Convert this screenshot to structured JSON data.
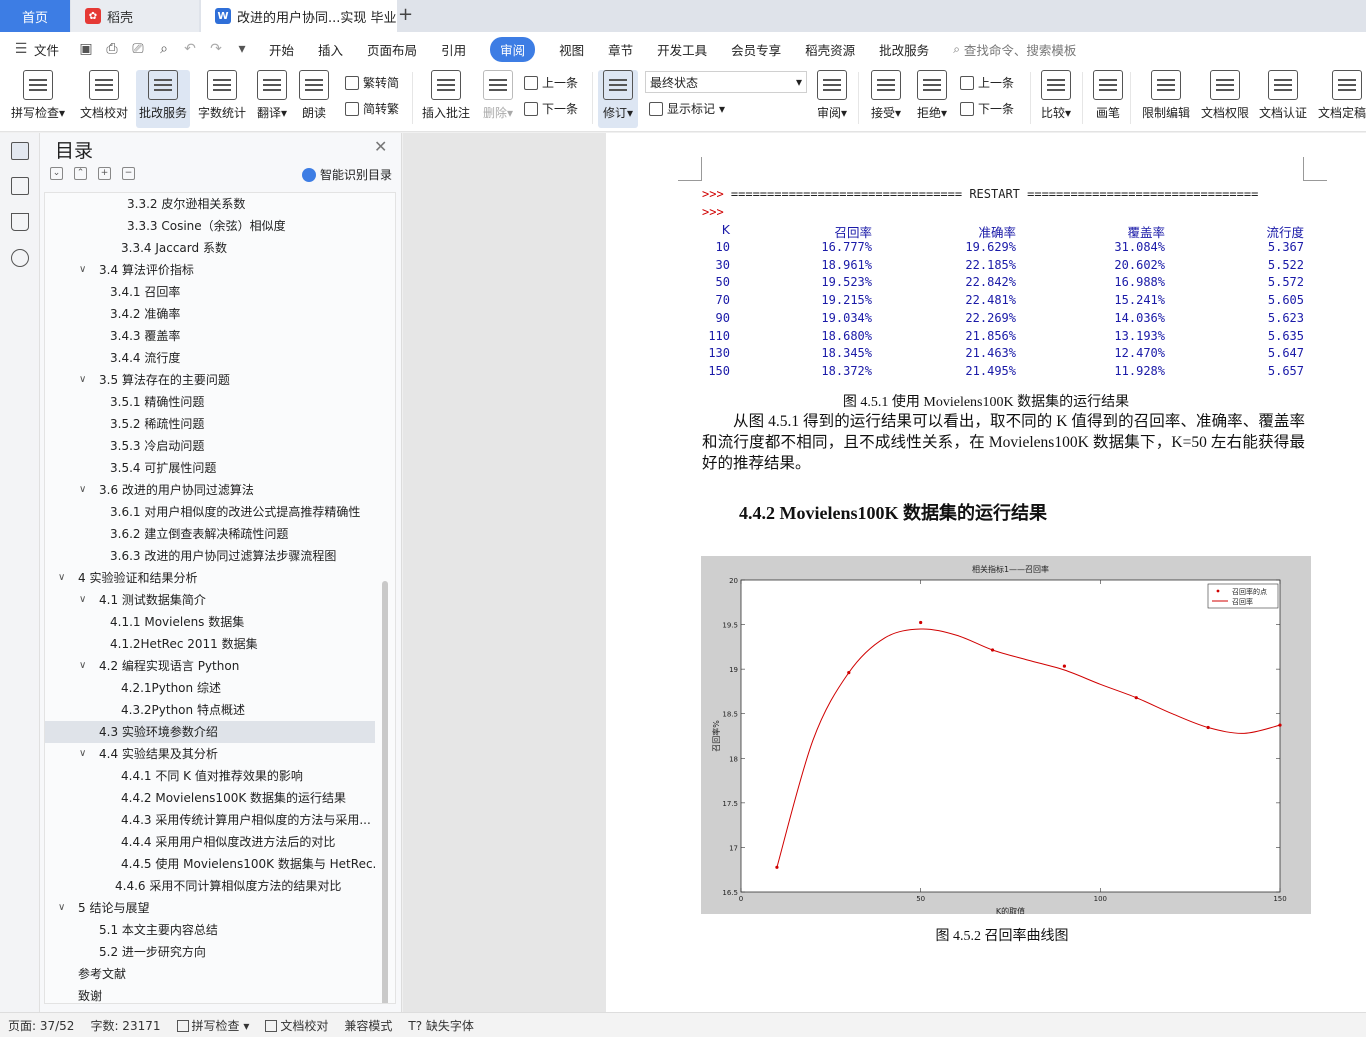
{
  "tabs": {
    "home": "首页",
    "daoke": "稻壳",
    "doc": "改进的用户协同...实现 毕业论文"
  },
  "menu": {
    "file": "文件",
    "items": [
      "开始",
      "插入",
      "页面布局",
      "引用",
      "审阅",
      "视图",
      "章节",
      "开发工具",
      "会员专享",
      "稻壳资源",
      "批改服务"
    ],
    "active": "审阅",
    "search": "查找命令、搜索模板"
  },
  "ribbon": {
    "spell": "拼写检查",
    "doc_check": "文档校对",
    "review_service": "批改服务",
    "word_count": "字数统计",
    "translate": "翻译",
    "read_aloud": "朗读",
    "trad": "繁转简",
    "simp": "简转繁",
    "insert_comment": "插入批注",
    "delete": "删除",
    "prev": "上一条",
    "next": "下一条",
    "track": "修订",
    "final_state": "最终状态",
    "show_marks": "显示标记",
    "review": "审阅",
    "accept": "接受",
    "reject": "拒绝",
    "prev2": "上一条",
    "next2": "下一条",
    "compare": "比较",
    "pen": "画笔",
    "restrict": "限制编辑",
    "perm": "文档权限",
    "cert": "文档认证",
    "final": "文档定稿"
  },
  "toc": {
    "title": "目录",
    "smart": "智能识别目录",
    "items": [
      {
        "text": "3.3.2 皮尔逊相关系数",
        "indent": 82,
        "chev": false
      },
      {
        "text": "3.3.3 Cosine（余弦）相似度",
        "indent": 82,
        "chev": false
      },
      {
        "text": "3.3.4 Jaccard  系数",
        "indent": 76,
        "chev": false
      },
      {
        "text": "3.4 算法评价指标",
        "indent": 54,
        "chev": true
      },
      {
        "text": "3.4.1 召回率",
        "indent": 65,
        "chev": false
      },
      {
        "text": "3.4.2 准确率",
        "indent": 65,
        "chev": false
      },
      {
        "text": "3.4.3 覆盖率",
        "indent": 65,
        "chev": false
      },
      {
        "text": "3.4.4 流行度",
        "indent": 65,
        "chev": false
      },
      {
        "text": "3.5 算法存在的主要问题",
        "indent": 54,
        "chev": true
      },
      {
        "text": "3.5.1 精确性问题",
        "indent": 65,
        "chev": false
      },
      {
        "text": "3.5.2 稀疏性问题",
        "indent": 65,
        "chev": false
      },
      {
        "text": "3.5.3 冷启动问题",
        "indent": 65,
        "chev": false
      },
      {
        "text": "3.5.4 可扩展性问题",
        "indent": 65,
        "chev": false
      },
      {
        "text": "3.6 改进的用户协同过滤算法",
        "indent": 54,
        "chev": true
      },
      {
        "text": "3.6.1 对用户相似度的改进公式提高推荐精确性",
        "indent": 65,
        "chev": false
      },
      {
        "text": "3.6.2 建立倒查表解决稀疏性问题",
        "indent": 65,
        "chev": false
      },
      {
        "text": "3.6.3 改进的用户协同过滤算法步骤流程图",
        "indent": 65,
        "chev": false
      },
      {
        "text": "4 实验验证和结果分析",
        "indent": 33,
        "chev": true
      },
      {
        "text": "4.1 测试数据集简介",
        "indent": 54,
        "chev": true
      },
      {
        "text": "4.1.1 Movielens 数据集",
        "indent": 65,
        "chev": false
      },
      {
        "text": "4.1.2HetRec 2011 数据集",
        "indent": 65,
        "chev": false
      },
      {
        "text": "4.2 编程实现语言 Python",
        "indent": 54,
        "chev": true
      },
      {
        "text": "4.2.1Python 综述",
        "indent": 76,
        "chev": false
      },
      {
        "text": "4.3.2Python 特点概述",
        "indent": 76,
        "chev": false
      },
      {
        "text": "4.3 实验环境参数介绍",
        "indent": 54,
        "chev": false,
        "selected": true
      },
      {
        "text": "4.4 实验结果及其分析",
        "indent": 54,
        "chev": true
      },
      {
        "text": "4.4.1 不同 K 值对推荐效果的影响",
        "indent": 76,
        "chev": false
      },
      {
        "text": "4.4.2 Movielens100K 数据集的运行结果",
        "indent": 76,
        "chev": false
      },
      {
        "text": "4.4.3 采用传统计算用户相似度的方法与采用...",
        "indent": 76,
        "chev": false
      },
      {
        "text": "4.4.4 采用用户相似度改进方法后的对比",
        "indent": 76,
        "chev": false
      },
      {
        "text": "4.4.5 使用 Movielens100K 数据集与 HetRec...",
        "indent": 76,
        "chev": false
      },
      {
        "text": "4.4.6 采用不同计算相似度方法的结果对比",
        "indent": 70,
        "chev": false
      },
      {
        "text": "5  结论与展望",
        "indent": 33,
        "chev": true
      },
      {
        "text": "5.1 本文主要内容总结",
        "indent": 54,
        "chev": false
      },
      {
        "text": "5.2 进一步研究方向",
        "indent": 54,
        "chev": false
      },
      {
        "text": "参考文献",
        "indent": 33,
        "chev": false
      },
      {
        "text": "致谢",
        "indent": 33,
        "chev": false
      }
    ]
  },
  "doc": {
    "restart_prefix": ">>>",
    "restart_line": " ================================ RESTART ================================",
    "prompt": ">>>",
    "headers": [
      "K",
      "召回率",
      "准确率",
      "覆盖率",
      "流行度"
    ],
    "rows": [
      [
        "10",
        "16.777%",
        "19.629%",
        "31.084%",
        "5.367"
      ],
      [
        "30",
        "18.961%",
        "22.185%",
        "20.602%",
        "5.522"
      ],
      [
        "50",
        "19.523%",
        "22.842%",
        "16.988%",
        "5.572"
      ],
      [
        "70",
        "19.215%",
        "22.481%",
        "15.241%",
        "5.605"
      ],
      [
        "90",
        "19.034%",
        "22.269%",
        "14.036%",
        "5.623"
      ],
      [
        "110",
        "18.680%",
        "21.856%",
        "13.193%",
        "5.635"
      ],
      [
        "130",
        "18.345%",
        "21.463%",
        "12.470%",
        "5.647"
      ],
      [
        "150",
        "18.372%",
        "21.495%",
        "11.928%",
        "5.657"
      ]
    ],
    "caption1": "图 4.5.1  使用 Movielens100K 数据集的运行结果",
    "paragraph": "从图 4.5.1 得到的运行结果可以看出，取不同的 K 值得到的召回率、准确率、覆盖率和流行度都不相同，且不成线性关系，在 Movielens100K 数据集下，K=50 左右能获得最好的推荐结果。",
    "heading": "4.4.2 Movielens100K 数据集的运行结果",
    "caption2": "图 4.5.2  召回率曲线图"
  },
  "chart_data": {
    "type": "line",
    "title": "相关指标1——召回率",
    "xlabel": "K的取值",
    "ylabel": "召回率%",
    "xlim": [
      0,
      150
    ],
    "ylim": [
      16.5,
      20
    ],
    "xticks": [
      "0",
      "50",
      "100",
      "150"
    ],
    "yticks": [
      "16.5",
      "17",
      "17.5",
      "18",
      "18.5",
      "19",
      "19.5",
      "20"
    ],
    "legend": [
      "召回率的点",
      "召回率"
    ],
    "legend_position": "top-right",
    "series": [
      {
        "name": "召回率的点",
        "x": [
          10,
          30,
          50,
          70,
          90,
          110,
          130,
          150
        ],
        "y": [
          16.777,
          18.961,
          19.523,
          19.215,
          19.034,
          18.68,
          18.345,
          18.372
        ]
      },
      {
        "name": "召回率",
        "x": [
          10,
          20,
          30,
          40,
          50,
          60,
          70,
          80,
          90,
          100,
          110,
          120,
          130,
          140,
          150
        ],
        "y": [
          16.777,
          18.2,
          18.961,
          19.35,
          19.45,
          19.38,
          19.215,
          19.1,
          18.99,
          18.83,
          18.68,
          18.5,
          18.345,
          18.28,
          18.372
        ]
      }
    ],
    "color": "#d00000"
  },
  "status": {
    "page": "页面: 37/52",
    "words": "字数: 23171",
    "spell": "拼写检查",
    "check": "文档校对",
    "compat": "兼容模式",
    "missing_font": "缺失字体"
  }
}
